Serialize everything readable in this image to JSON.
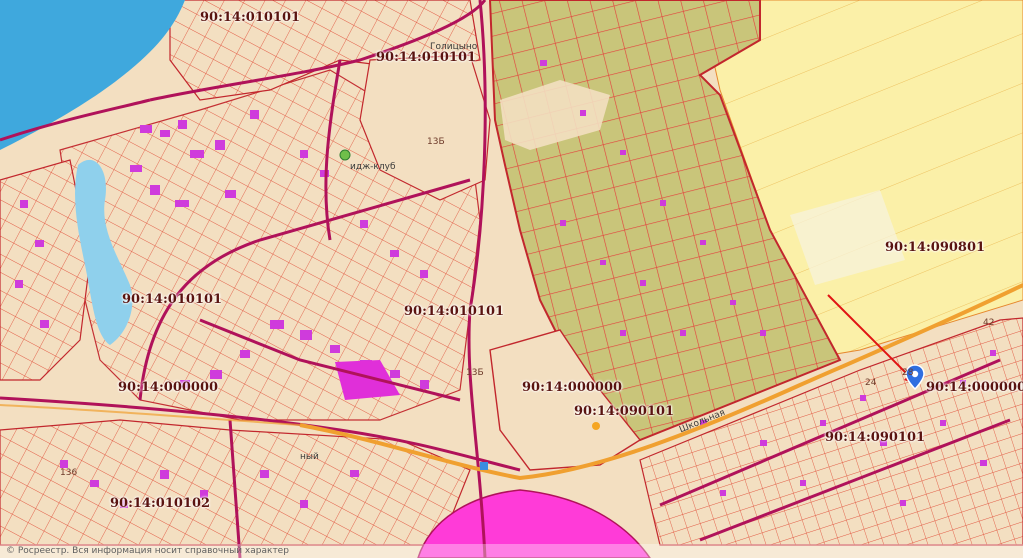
{
  "map": {
    "cadastral_labels": [
      {
        "id": "q-top",
        "text": "90:14:010101"
      },
      {
        "id": "q-top2",
        "text": "90:14:010101"
      },
      {
        "id": "q-east",
        "text": "90:14:090801"
      },
      {
        "id": "q-west",
        "text": "90:14:010101"
      },
      {
        "id": "q-center",
        "text": "90:14:010101"
      },
      {
        "id": "q-left-low",
        "text": "90:14:000000"
      },
      {
        "id": "q-center-low",
        "text": "90:14:000000"
      },
      {
        "id": "q-center-low2",
        "text": "90:14:090101"
      },
      {
        "id": "q-right",
        "text": "90:14:000000"
      },
      {
        "id": "q-right-low",
        "text": "90:14:090101"
      },
      {
        "id": "q-bottom-left",
        "text": "90:14:010102"
      }
    ],
    "parcel_numbers": [
      "13Б",
      "13Б",
      "136",
      "24",
      "28",
      "42"
    ],
    "place_labels": {
      "club": "идж-клуб",
      "street": "Школьная",
      "village_north": "Голицыно",
      "bottom_place": "ный"
    },
    "attribution": "© Росреестр. Вся информация носит справочный характер",
    "colors": {
      "land": "#f3dfc1",
      "water": "#8fd0ec",
      "sea": "#3fa8dd",
      "garden_zone": "#c9c57a",
      "field_zone": "#fbf0a8",
      "parcel_line": "#e0303a",
      "building": "#cf3bdc",
      "major_road": "#b0125a",
      "highway": "#f0a030",
      "pink_zone": "#ff3bd8",
      "arrow": "#e01414",
      "pin": "#2f6fe0"
    },
    "marker_icon": "location-pin-icon",
    "arrow_icon": "pointer-arrow-icon"
  }
}
